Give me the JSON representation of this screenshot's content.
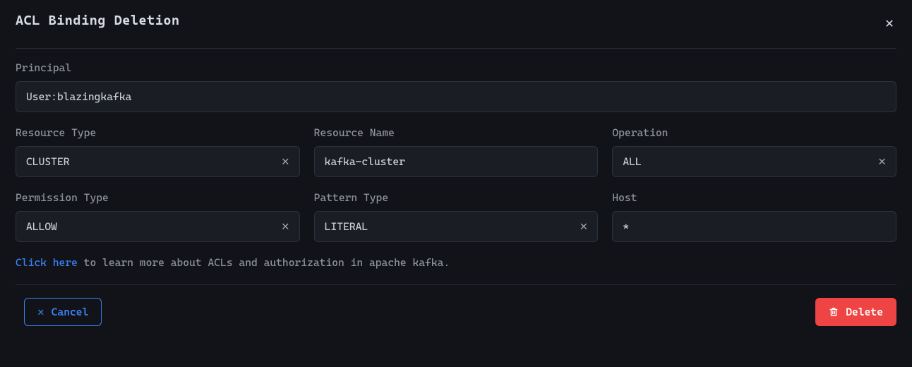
{
  "dialog": {
    "title": "ACL Binding Deletion"
  },
  "fields": {
    "principal": {
      "label": "Principal",
      "value": "User:blazingkafka"
    },
    "resource_type": {
      "label": "Resource Type",
      "value": "CLUSTER"
    },
    "resource_name": {
      "label": "Resource Name",
      "value": "kafka-cluster"
    },
    "operation": {
      "label": "Operation",
      "value": "ALL"
    },
    "permission_type": {
      "label": "Permission Type",
      "value": "ALLOW"
    },
    "pattern_type": {
      "label": "Pattern Type",
      "value": "LITERAL"
    },
    "host": {
      "label": "Host",
      "value": "*"
    }
  },
  "help": {
    "link_text": "Click here",
    "rest": " to learn more about ACLs and authorization in apache kafka."
  },
  "buttons": {
    "cancel": "Cancel",
    "delete": "Delete"
  }
}
